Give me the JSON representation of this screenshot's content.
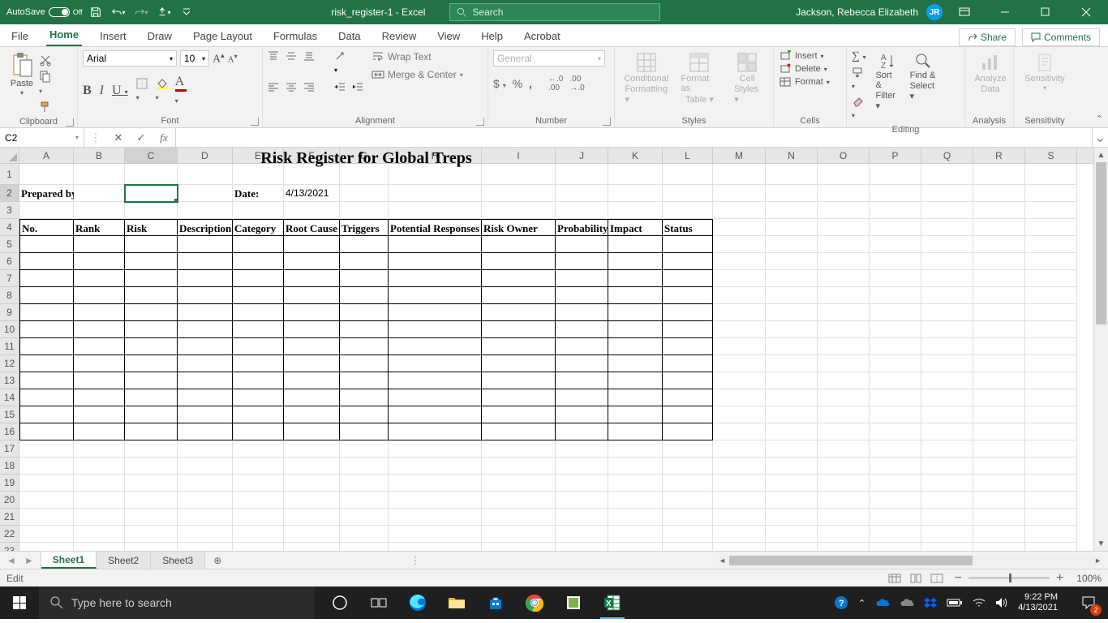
{
  "titlebar": {
    "autosave_label": "AutoSave",
    "autosave_state": "Off",
    "filename": "risk_register-1  -  Excel",
    "search_placeholder": "Search",
    "user": "Jackson, Rebecca Elizabeth",
    "initials": "JR"
  },
  "tabs": {
    "items": [
      "File",
      "Home",
      "Insert",
      "Draw",
      "Page Layout",
      "Formulas",
      "Data",
      "Review",
      "View",
      "Help",
      "Acrobat"
    ],
    "active": "Home",
    "share": "Share",
    "comments": "Comments"
  },
  "ribbon": {
    "clipboard": {
      "paste": "Paste",
      "label": "Clipboard"
    },
    "font": {
      "name": "Arial",
      "size": "10",
      "label": "Font"
    },
    "alignment": {
      "wrap": "Wrap Text",
      "merge": "Merge & Center",
      "label": "Alignment"
    },
    "number": {
      "format": "General",
      "label": "Number"
    },
    "styles": {
      "cond": "Conditional Formatting",
      "table": "Format as Table",
      "cell": "Cell Styles",
      "label": "Styles"
    },
    "cells": {
      "insert": "Insert",
      "delete": "Delete",
      "format": "Format",
      "label": "Cells"
    },
    "editing": {
      "sort": "Sort & Filter",
      "find": "Find & Select",
      "label": "Editing"
    },
    "analysis": {
      "analyze": "Analyze Data",
      "label": "Analysis"
    },
    "sensitivity": {
      "btn": "Sensitivity",
      "label": "Sensitivity"
    }
  },
  "namebox": {
    "ref": "C2"
  },
  "sheet": {
    "title": "Risk Register for Global Treps",
    "prepared_by": "Prepared by:",
    "date_label": "Date:",
    "date_value": "4/13/2021",
    "headers": [
      "No.",
      "Rank",
      "Risk",
      "Description",
      "Category",
      "Root Cause",
      "Triggers",
      "Potential Responses",
      "Risk Owner",
      "Probability",
      "Impact",
      "Status"
    ]
  },
  "sheet_tabs": {
    "items": [
      "Sheet1",
      "Sheet2",
      "Sheet3"
    ],
    "active": "Sheet1"
  },
  "statusbar": {
    "mode": "Edit",
    "zoom": "100%"
  },
  "taskbar": {
    "search": "Type here to search",
    "time": "9:22 PM",
    "date": "4/13/2021",
    "badge": "2"
  },
  "columns": [
    {
      "l": "A",
      "w": 67
    },
    {
      "l": "B",
      "w": 63
    },
    {
      "l": "C",
      "w": 65
    },
    {
      "l": "D",
      "w": 68
    },
    {
      "l": "E",
      "w": 63
    },
    {
      "l": "F",
      "w": 69
    },
    {
      "l": "G",
      "w": 60
    },
    {
      "l": "H",
      "w": 115
    },
    {
      "l": "I",
      "w": 91
    },
    {
      "l": "J",
      "w": 65
    },
    {
      "l": "K",
      "w": 67
    },
    {
      "l": "L",
      "w": 62
    },
    {
      "l": "M",
      "w": 65
    },
    {
      "l": "N",
      "w": 64
    },
    {
      "l": "O",
      "w": 64
    },
    {
      "l": "P",
      "w": 64
    },
    {
      "l": "Q",
      "w": 64
    },
    {
      "l": "R",
      "w": 64
    },
    {
      "l": "S",
      "w": 64
    }
  ],
  "chart_data": null
}
